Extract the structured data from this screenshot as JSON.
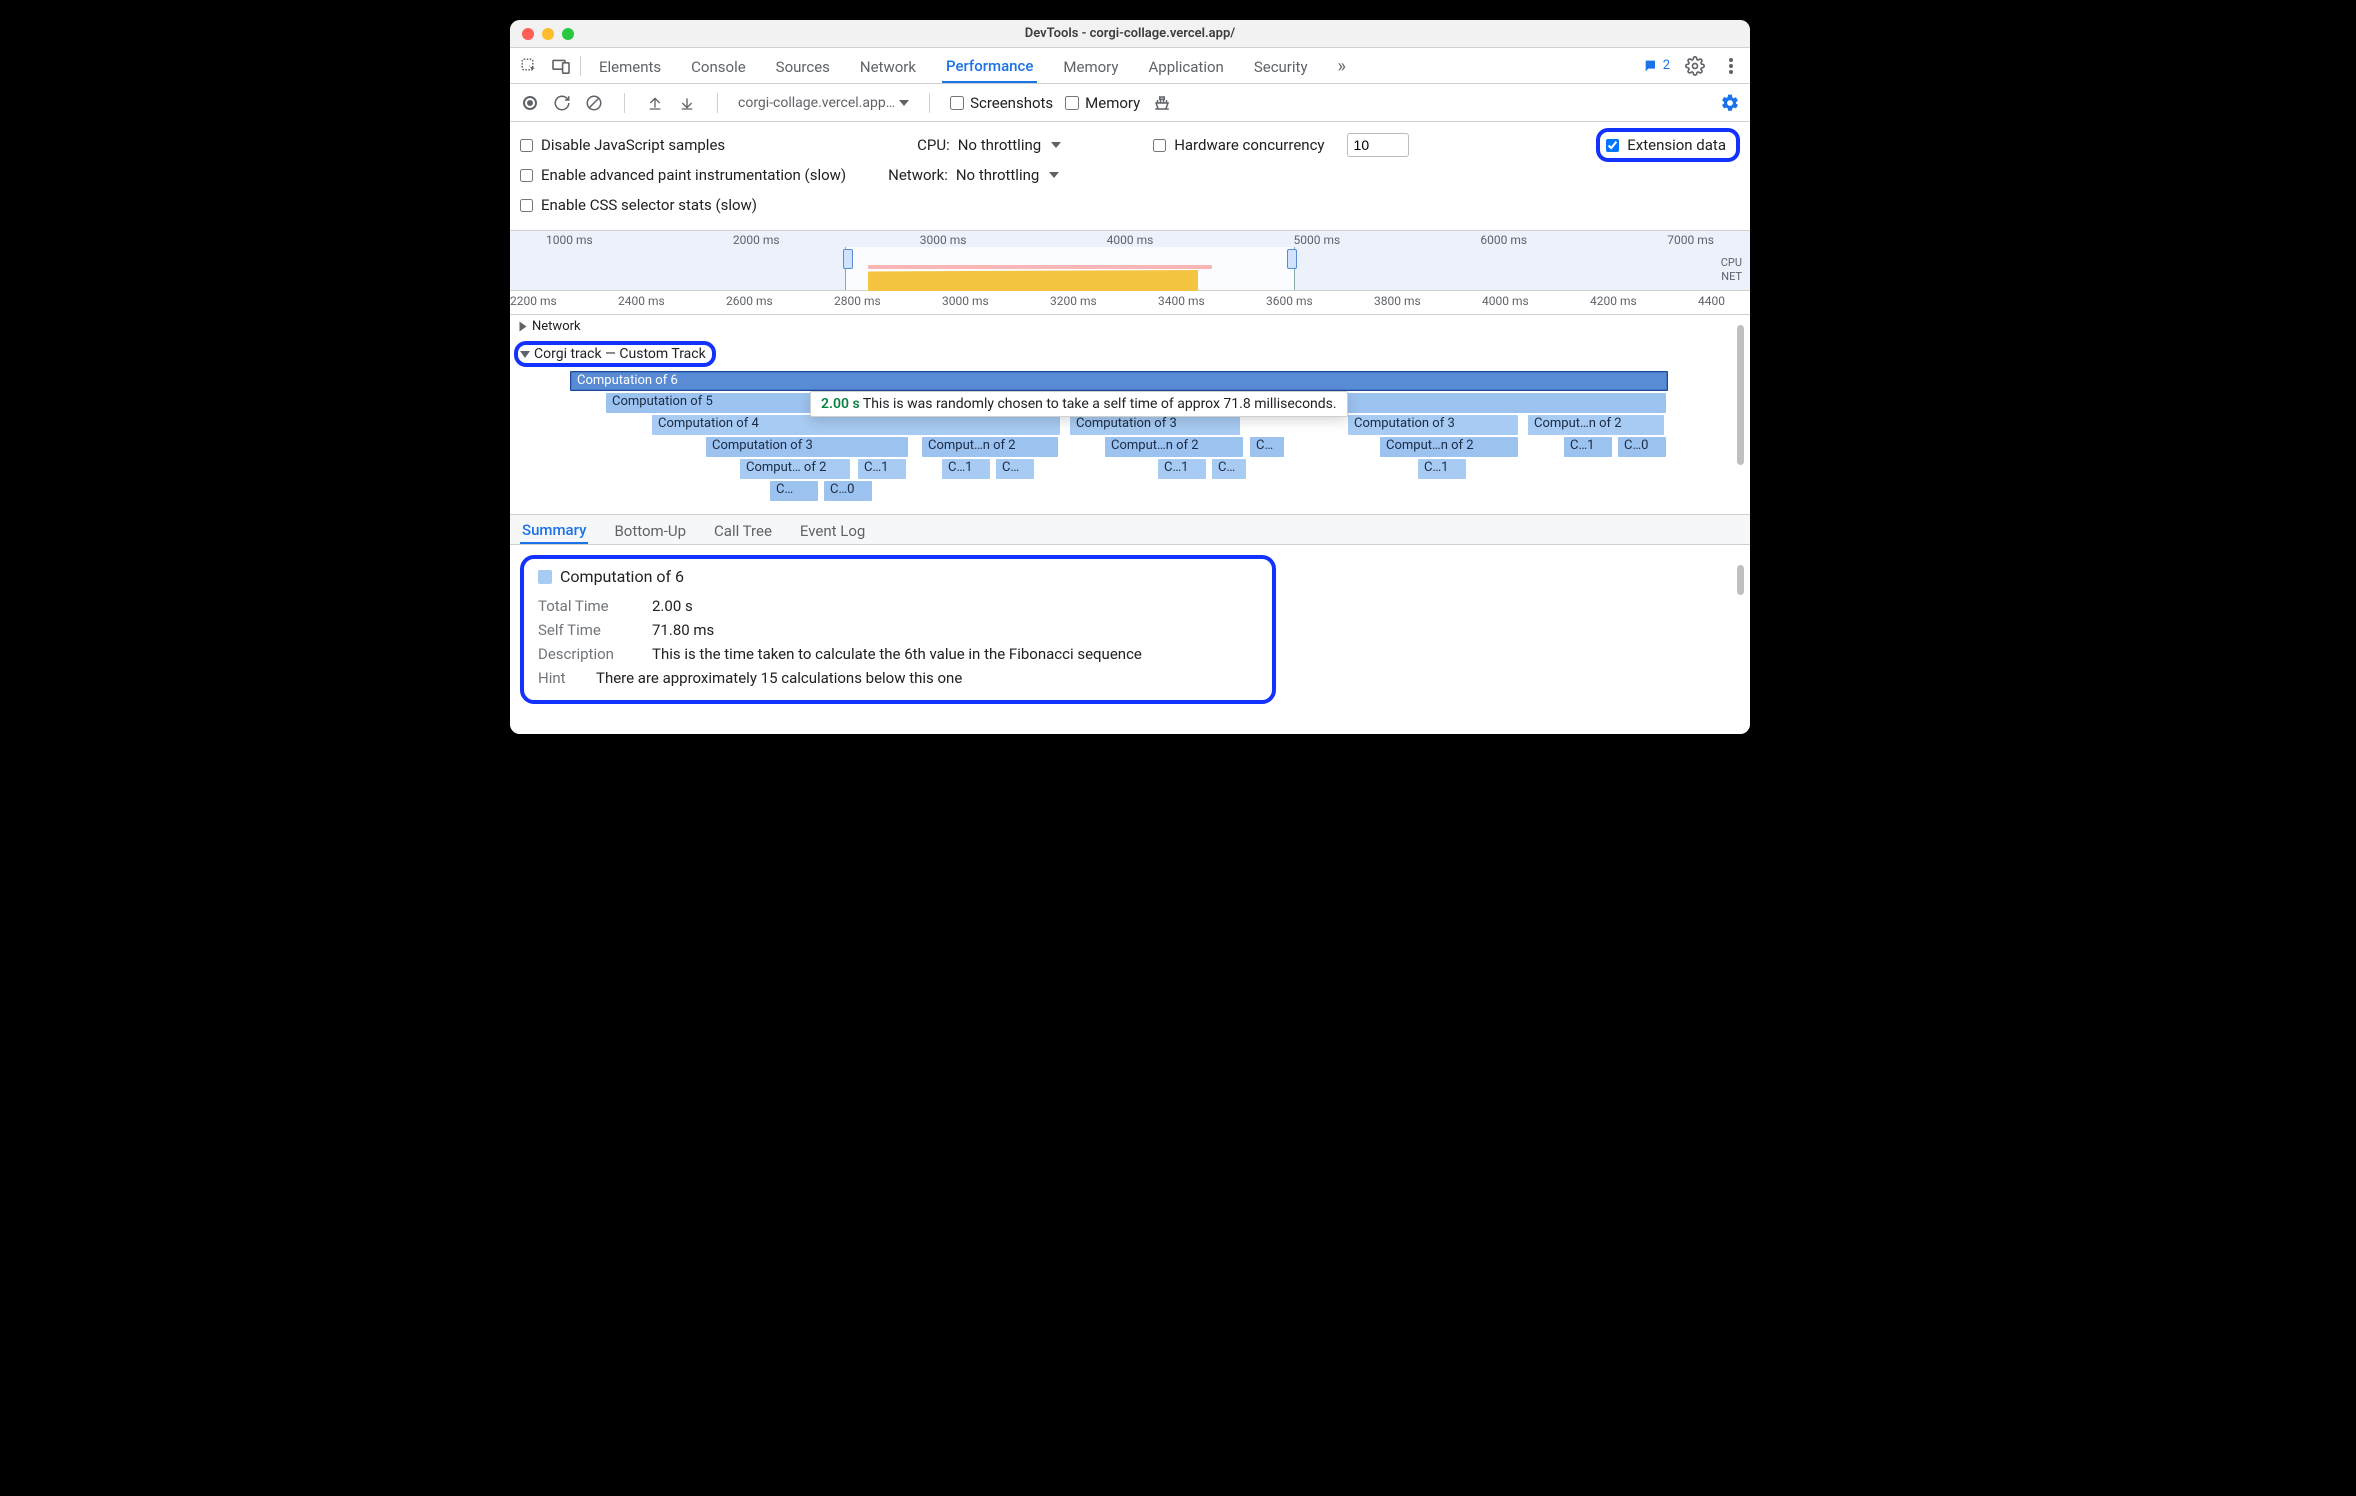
{
  "window": {
    "title": "DevTools - corgi-collage.vercel.app/"
  },
  "tabs": {
    "left": [
      "Elements",
      "Console",
      "Sources",
      "Network",
      "Performance",
      "Memory",
      "Application",
      "Security"
    ],
    "active": "Performance",
    "more": "»",
    "issues_count": "2"
  },
  "toolbar": {
    "target": "corgi-collage.vercel.app…",
    "screenshots": "Screenshots",
    "memory": "Memory"
  },
  "settings": {
    "disable_js": "Disable JavaScript samples",
    "cpu_label": "CPU:",
    "cpu_value": "No throttling",
    "hw_conc_label": "Hardware concurrency",
    "hw_conc_value": "10",
    "ext_data": "Extension data",
    "adv_paint": "Enable advanced paint instrumentation (slow)",
    "net_label": "Network:",
    "net_value": "No throttling",
    "css_stats": "Enable CSS selector stats (slow)"
  },
  "overview": {
    "ticks": [
      "1000 ms",
      "2000 ms",
      "3000 ms",
      "4000 ms",
      "5000 ms",
      "6000 ms",
      "7000 ms"
    ],
    "side_cpu": "CPU",
    "side_net": "NET"
  },
  "ruler": {
    "ticks": [
      "2200 ms",
      "2400 ms",
      "2600 ms",
      "2800 ms",
      "3000 ms",
      "3200 ms",
      "3400 ms",
      "3600 ms",
      "3800 ms",
      "4000 ms",
      "4200 ms",
      "4400"
    ]
  },
  "flame": {
    "network_group": "Network",
    "custom_group": "Corgi track — Custom Track",
    "bars": {
      "c6": "Computation of 6",
      "c5": "Computation of 5",
      "c4a": "Computation of 4",
      "c4b": "Computation of 3",
      "c4c": "Computation of 3",
      "c4d": "Comput…n of 2",
      "c3a": "Computation of 3",
      "c3b": "Comput…n of 2",
      "c3c": "Comput…n of 2",
      "c3d": "C…",
      "c3e": "Comput…n of 2",
      "c3f": "C…1",
      "c3g": "C…0",
      "c2a": "Comput… of 2",
      "c2b": "C…1",
      "c2c": "C…1",
      "c2d": "C…",
      "c2e": "C…1",
      "c2f": "C…",
      "c2g": "C…1",
      "c1a": "C…",
      "c1b": "C…0"
    },
    "tooltip_time": "2.00 s",
    "tooltip_text": "This is was randomly chosen to take a self time of approx 71.8 milliseconds."
  },
  "dettabs": {
    "summary": "Summary",
    "bottomup": "Bottom-Up",
    "calltree": "Call Tree",
    "eventlog": "Event Log"
  },
  "summary": {
    "title": "Computation of 6",
    "total_k": "Total Time",
    "total_v": "2.00 s",
    "self_k": "Self Time",
    "self_v": "71.80 ms",
    "desc_k": "Description",
    "desc_v": "This is the time taken to calculate the 6th value in the Fibonacci sequence",
    "hint_k": "Hint",
    "hint_v": "There are approximately 15 calculations below this one"
  }
}
